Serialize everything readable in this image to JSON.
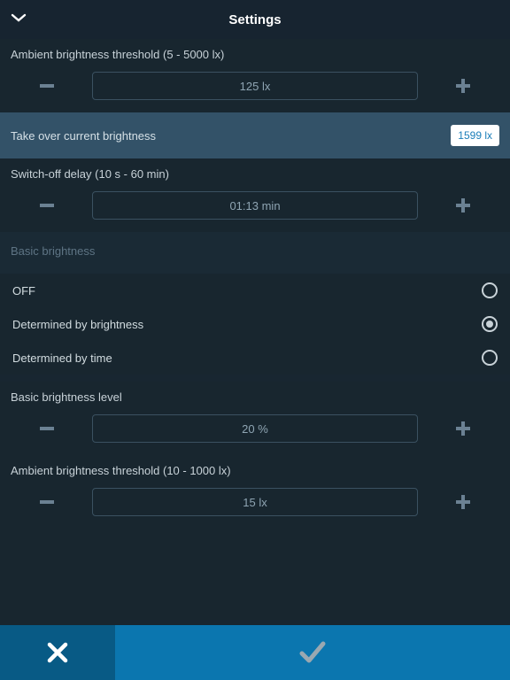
{
  "header": {
    "title": "Settings"
  },
  "ambient1": {
    "label": "Ambient brightness threshold (5 - 5000 lx)",
    "value": "125 lx"
  },
  "takeover": {
    "label": "Take over current brightness",
    "value": "1599 lx"
  },
  "delay": {
    "label": "Switch-off delay (10 s - 60 min)",
    "value": "01:13 min"
  },
  "group": {
    "label": "Basic brightness"
  },
  "radios": {
    "off": "OFF",
    "bri": "Determined by brightness",
    "time": "Determined by time"
  },
  "level": {
    "label": "Basic brightness level",
    "value": "20 %"
  },
  "ambient2": {
    "label": "Ambient brightness threshold (10 - 1000 lx)",
    "value": "15 lx"
  }
}
